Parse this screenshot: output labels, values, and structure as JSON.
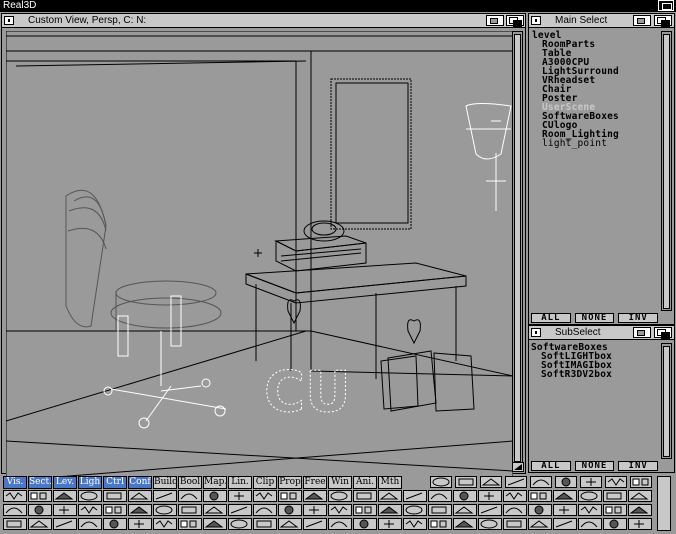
{
  "screen": {
    "title": "Real3D"
  },
  "viewport": {
    "title": "Custom View, Persp, C: N:"
  },
  "main_select": {
    "title": "Main Select",
    "items": [
      {
        "label": "level",
        "indent": false,
        "selected": false
      },
      {
        "label": "RoomParts",
        "indent": true,
        "selected": false
      },
      {
        "label": "Table",
        "indent": true,
        "selected": false
      },
      {
        "label": "A3000CPU",
        "indent": true,
        "selected": false
      },
      {
        "label": "LightSurround",
        "indent": true,
        "selected": false
      },
      {
        "label": "VRheadset",
        "indent": true,
        "selected": false
      },
      {
        "label": "Chair",
        "indent": true,
        "selected": false
      },
      {
        "label": "Poster",
        "indent": true,
        "selected": false
      },
      {
        "label": "UserScene",
        "indent": true,
        "selected": true
      },
      {
        "label": "SoftwareBoxes",
        "indent": true,
        "selected": false
      },
      {
        "label": "CUlogo",
        "indent": true,
        "selected": false
      },
      {
        "label": "Room_Lighting",
        "indent": true,
        "selected": false
      },
      {
        "label": "light_point",
        "indent": true,
        "selected": false,
        "light": true
      }
    ],
    "buttons": {
      "all": "ALL",
      "none": "NONE",
      "inv": "INV"
    }
  },
  "sub_select": {
    "title": "SubSelect",
    "items": [
      {
        "label": "SoftwareBoxes",
        "indent": false
      },
      {
        "label": "SoftLIGHTbox",
        "indent": true
      },
      {
        "label": "SoftIMAGIbox",
        "indent": true
      },
      {
        "label": "SoftR3DV2box",
        "indent": true
      }
    ],
    "buttons": {
      "all": "ALL",
      "none": "NONE",
      "inv": "INV"
    }
  },
  "toolbar": {
    "tabs": [
      {
        "label": "Vis.",
        "active": true
      },
      {
        "label": "Sect.",
        "active": true
      },
      {
        "label": "Lev.",
        "active": true
      },
      {
        "label": "Ligh",
        "active": true
      },
      {
        "label": "Ctrl",
        "active": true
      },
      {
        "label": "Conf",
        "active": true
      },
      {
        "label": "Build",
        "active": false
      },
      {
        "label": "Bool",
        "active": false
      },
      {
        "label": "Map.",
        "active": false
      },
      {
        "label": "Lin.",
        "active": false
      },
      {
        "label": "Clip",
        "active": false
      },
      {
        "label": "Prop",
        "active": false
      },
      {
        "label": "Free",
        "active": false
      },
      {
        "label": "Win",
        "active": false
      },
      {
        "label": "Ani.",
        "active": false
      },
      {
        "label": "Mth",
        "active": false
      }
    ]
  },
  "colors": {
    "background": "#9a9a9a",
    "active_tab": "#4a78c6",
    "title_bar": "#000000",
    "gadget": "#c8c8c8"
  }
}
